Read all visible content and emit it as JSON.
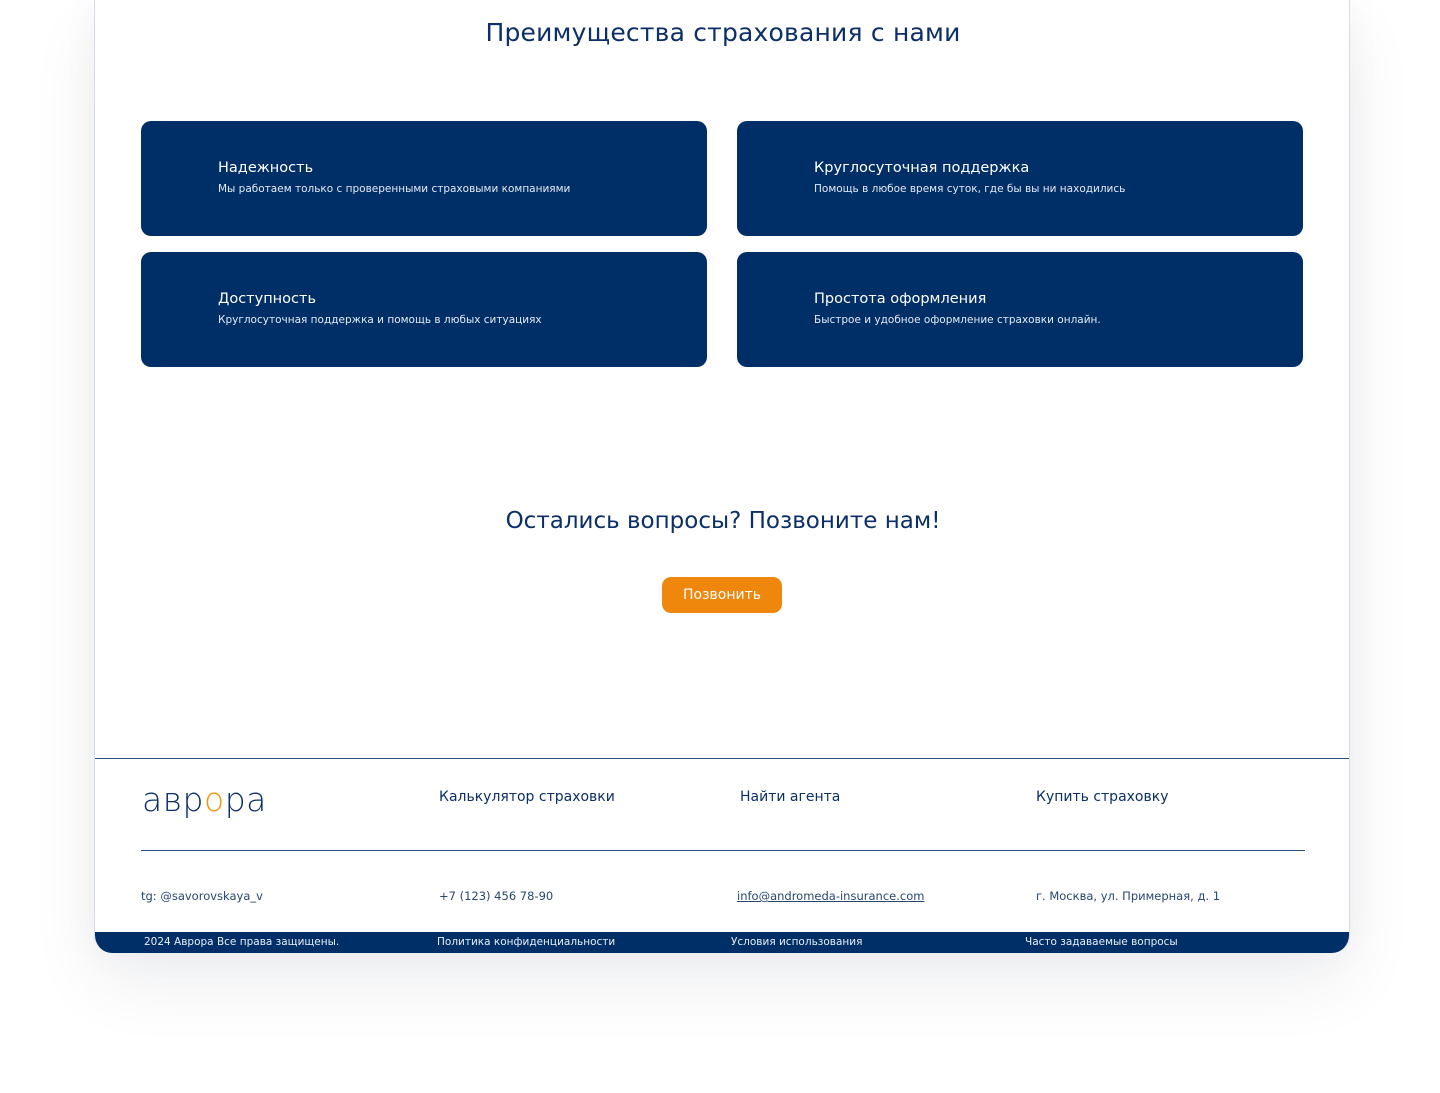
{
  "advantages": {
    "title": "Преимущества страхования с нами",
    "cards": [
      {
        "title": "Надежность",
        "description": "Мы работаем только с проверенными страховыми компаниями"
      },
      {
        "title": "Круглосуточная поддержка",
        "description": "Помощь в любое время суток, где бы вы ни находились"
      },
      {
        "title": "Доступность",
        "description": "Круглосуточная поддержка и помощь в любых ситуациях"
      },
      {
        "title": "Простота оформления",
        "description": "Быстрое и удобное оформление страховки онлайн."
      }
    ]
  },
  "questions": {
    "title": "Остались вопросы? Позвоните нам!",
    "button_label": "Позвонить"
  },
  "footer": {
    "logo": {
      "part1": "авр",
      "accent": "о",
      "part2": "ра"
    },
    "links": [
      "Калькулятор страховки",
      "Найти агента",
      "Купить страховку"
    ],
    "contacts": {
      "telegram": "tg: @savorovskaya_v",
      "phone": "+7 (123) 456 78-90",
      "email": "info@andromeda-insurance.com",
      "address": "г. Москва, ул. Примерная, д. 1"
    },
    "bottom": {
      "copyright": "2024 Аврора  Все права защищены.",
      "privacy": "Политика конфиденциальности",
      "terms": "Условия использования",
      "faq": "Часто задаваемые вопросы"
    }
  },
  "colors": {
    "navy": "#002f67",
    "heading": "#0b2f66",
    "accent_orange": "#f0870d",
    "background": "#ffffff"
  }
}
